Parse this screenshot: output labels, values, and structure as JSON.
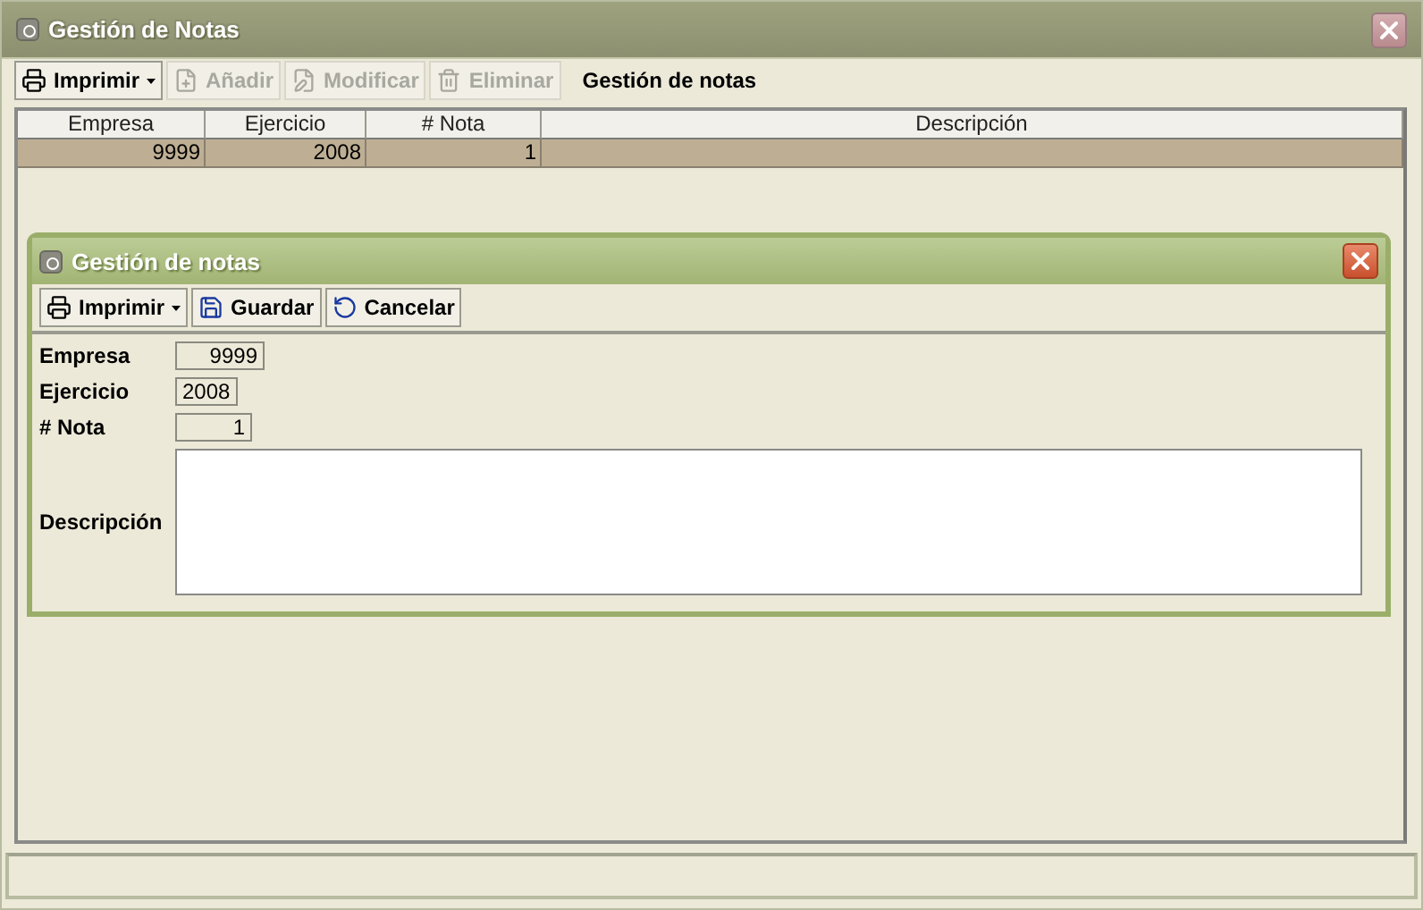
{
  "window": {
    "title": "Gestión de Notas"
  },
  "toolbar": {
    "buttons": [
      {
        "label": "Imprimir",
        "kind": "print",
        "disabled": false,
        "dropdown": true
      },
      {
        "label": "Añadir",
        "kind": "add",
        "disabled": true,
        "dropdown": false
      },
      {
        "label": "Modificar",
        "kind": "edit",
        "disabled": true,
        "dropdown": false
      },
      {
        "label": "Eliminar",
        "kind": "delete",
        "disabled": true,
        "dropdown": false
      }
    ],
    "caption": "Gestión de notas"
  },
  "table": {
    "columns": [
      "Empresa",
      "Ejercicio",
      "# Nota",
      "Descripción"
    ],
    "rows": [
      {
        "cells": [
          "9999",
          "2008",
          "1"
        ],
        "selected": true
      }
    ]
  },
  "dialog": {
    "title": "Gestión de notas",
    "buttons": [
      {
        "label": "Imprimir",
        "kind": "print",
        "disabled": false,
        "dropdown": true
      },
      {
        "label": "Guardar",
        "kind": "save",
        "disabled": false,
        "dropdown": false
      },
      {
        "label": "Cancelar",
        "kind": "cancel",
        "disabled": false,
        "dropdown": false
      }
    ],
    "fields": [
      {
        "label": "Empresa",
        "value": "9999",
        "kind": "number"
      },
      {
        "label": "Ejercicio",
        "value": "2008",
        "kind": "text"
      },
      {
        "label": "# Nota",
        "value": "1",
        "kind": "number"
      },
      {
        "label": "Descripción",
        "kind": "multiline"
      }
    ]
  }
}
